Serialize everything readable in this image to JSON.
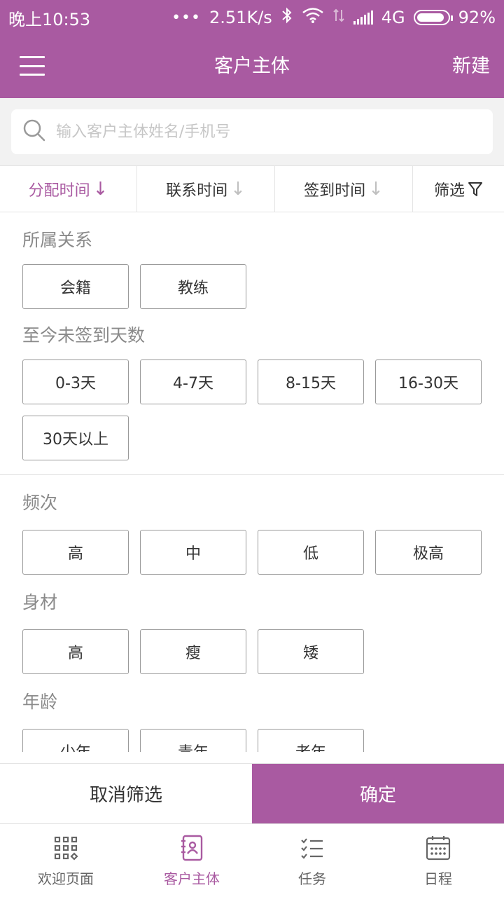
{
  "status_bar": {
    "time": "晚上10:53",
    "dots": "•••",
    "speed": "2.51K/s",
    "network": "4G",
    "battery": "92%"
  },
  "app_bar": {
    "title": "客户主体",
    "new_label": "新建"
  },
  "search": {
    "placeholder": "输入客户主体姓名/手机号"
  },
  "sort_bar": {
    "items": [
      {
        "label": "分配时间",
        "active": true
      },
      {
        "label": "联系时间",
        "active": false
      },
      {
        "label": "签到时间",
        "active": false
      }
    ],
    "filter_label": "筛选"
  },
  "filters": {
    "relation": {
      "title": "所属关系",
      "options": [
        "会籍",
        "教练"
      ]
    },
    "days": {
      "title": "至今未签到天数",
      "options": [
        "0-3天",
        "4-7天",
        "8-15天",
        "16-30天",
        "30天以上"
      ]
    },
    "frequency": {
      "title": "频次",
      "options": [
        "高",
        "中",
        "低",
        "极高"
      ]
    },
    "body": {
      "title": "身材",
      "options": [
        "高",
        "瘦",
        "矮"
      ]
    },
    "age": {
      "title": "年龄",
      "options": [
        "少年",
        "青年",
        "老年"
      ]
    }
  },
  "actions": {
    "cancel_label": "取消筛选",
    "confirm_label": "确定"
  },
  "tabs": [
    {
      "label": "欢迎页面",
      "icon": "grid-icon",
      "active": false
    },
    {
      "label": "客户主体",
      "icon": "contacts-book-icon",
      "active": true
    },
    {
      "label": "任务",
      "icon": "task-list-icon",
      "active": false
    },
    {
      "label": "日程",
      "icon": "calendar-icon",
      "active": false
    }
  ],
  "colors": {
    "accent": "#a95aa1"
  }
}
